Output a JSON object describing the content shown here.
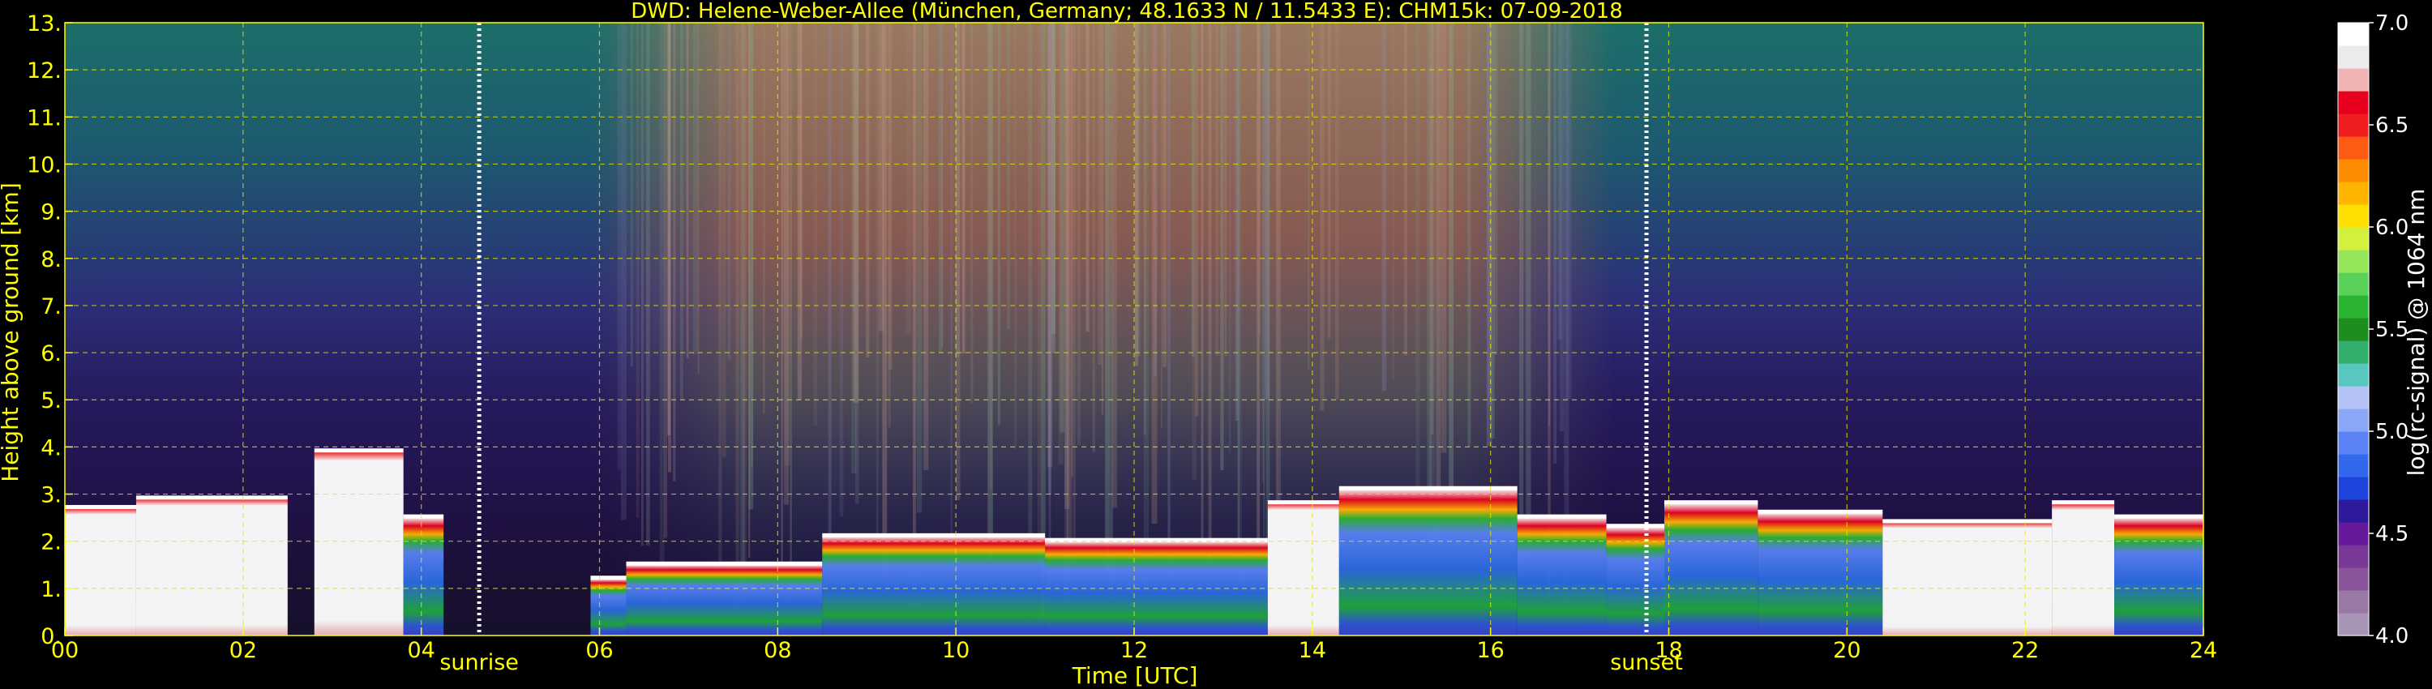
{
  "chart_data": {
    "type": "heatmap",
    "title": "DWD: Helene-Weber-Allee (München, Germany; 48.1633 N / 11.5433 E):    CHM15k: 07-09-2018",
    "xlabel": "Time [UTC]",
    "ylabel": "Height above ground [km]",
    "xlim": [
      0,
      24
    ],
    "ylim": [
      0,
      13
    ],
    "xticks": [
      0,
      2,
      4,
      6,
      8,
      10,
      12,
      14,
      16,
      18,
      20,
      22,
      24
    ],
    "xticklabels": [
      "00",
      "02",
      "04",
      "06",
      "08",
      "10",
      "12",
      "14",
      "16",
      "18",
      "20",
      "22",
      "24"
    ],
    "yticks": [
      0,
      1,
      2,
      3,
      4,
      5,
      6,
      7,
      8,
      9,
      10,
      11,
      12,
      13
    ],
    "yticklabels": [
      "0.",
      "1.",
      "2.",
      "3.",
      "4.",
      "5.",
      "6.",
      "7.",
      "8.",
      "9.",
      "10.",
      "11.",
      "12.",
      "13."
    ],
    "grid": true,
    "annotations": [
      {
        "label": "sunrise",
        "x": 4.65
      },
      {
        "label": "sunset",
        "x": 17.75
      }
    ],
    "colorbar": {
      "label": "log(rc-signal) @ 1064 nm",
      "range": [
        4.0,
        7.0
      ],
      "ticks": [
        4.0,
        4.5,
        5.0,
        5.5,
        6.0,
        6.5,
        7.0
      ],
      "ticklabels": [
        "4.0",
        "4.5",
        "5.0",
        "5.5",
        "6.0",
        "6.5",
        "7.0"
      ],
      "colors": [
        "#a894b4",
        "#9a78a6",
        "#8a549a",
        "#7a3896",
        "#66189a",
        "#2d1a9a",
        "#1e44dc",
        "#3268ec",
        "#5a82f4",
        "#8aa6f6",
        "#b4c2f6",
        "#5ac6c0",
        "#32ae6c",
        "#1e8c1e",
        "#2ab432",
        "#5ad25a",
        "#96e65a",
        "#d2f03c",
        "#ffe000",
        "#ffb400",
        "#ff8c00",
        "#ff5a14",
        "#f01e1e",
        "#e6001e",
        "#f0b4b4",
        "#ebebeb",
        "#ffffff"
      ]
    },
    "layers": [
      {
        "name": "cloud_layers",
        "units": "km",
        "segments": [
          {
            "x": [
              0.0,
              0.8
            ],
            "y": [
              0.0,
              2.7
            ]
          },
          {
            "x": [
              0.8,
              2.5
            ],
            "y": [
              0.0,
              2.9
            ]
          },
          {
            "x": [
              2.8,
              3.8
            ],
            "y": [
              0.0,
              3.9
            ]
          },
          {
            "x": [
              3.8,
              4.25
            ],
            "y": [
              0.0,
              2.5
            ]
          },
          {
            "x": [
              5.9,
              6.3
            ],
            "y": [
              0.0,
              1.2
            ]
          },
          {
            "x": [
              6.3,
              8.5
            ],
            "y": [
              0.0,
              1.5
            ]
          },
          {
            "x": [
              8.5,
              11.0
            ],
            "y": [
              0.0,
              2.1
            ]
          },
          {
            "x": [
              11.0,
              13.5
            ],
            "y": [
              0.0,
              2.0
            ]
          },
          {
            "x": [
              13.5,
              14.3
            ],
            "y": [
              0.0,
              2.8
            ]
          },
          {
            "x": [
              14.3,
              16.3
            ],
            "y": [
              0.0,
              3.1
            ]
          },
          {
            "x": [
              16.3,
              17.3
            ],
            "y": [
              0.0,
              2.5
            ]
          },
          {
            "x": [
              17.3,
              17.95
            ],
            "y": [
              0.0,
              2.3
            ]
          },
          {
            "x": [
              17.95,
              19.0
            ],
            "y": [
              0.0,
              2.8
            ]
          },
          {
            "x": [
              19.0,
              20.4
            ],
            "y": [
              0.0,
              2.6
            ]
          },
          {
            "x": [
              20.4,
              22.3
            ],
            "y": [
              0.0,
              2.4
            ]
          },
          {
            "x": [
              22.3,
              23.0
            ],
            "y": [
              0.0,
              2.8
            ]
          },
          {
            "x": [
              23.0,
              24.0
            ],
            "y": [
              0.0,
              2.5
            ]
          }
        ]
      }
    ]
  }
}
